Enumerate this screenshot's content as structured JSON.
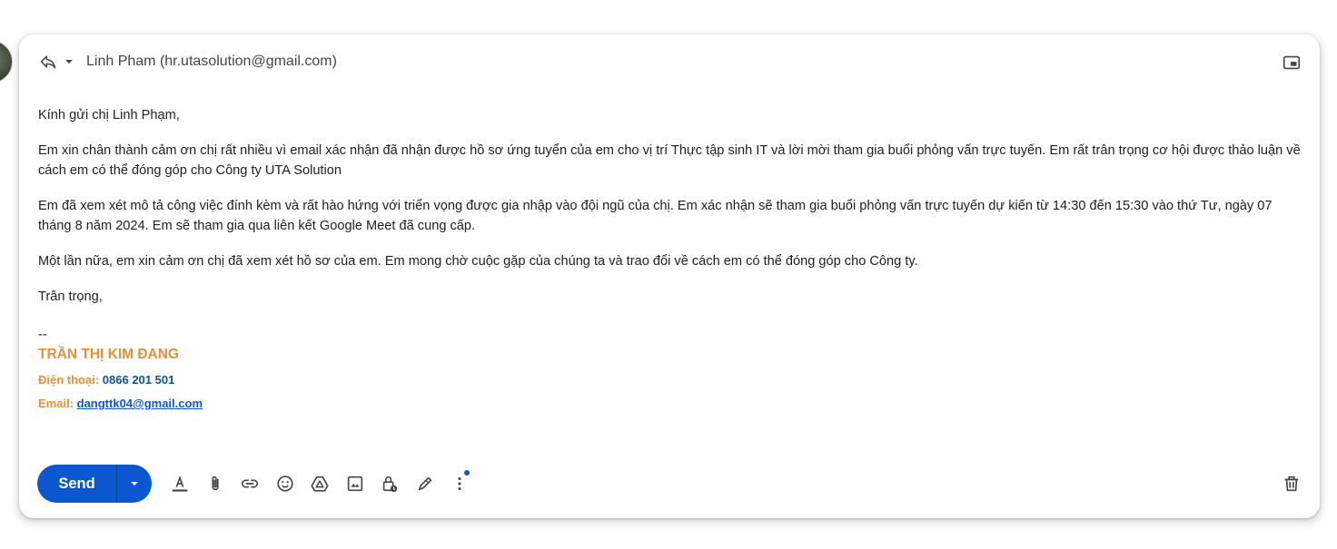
{
  "header": {
    "recipient": "Linh Pham (hr.utasolution@gmail.com)"
  },
  "body": {
    "greeting": "Kính gửi chị Linh Phạm,",
    "paragraphs": [
      "Em xin chân thành cảm ơn chị rất nhiều vì email xác nhận đã nhận được hồ sơ ứng tuyển của em cho vị trí Thực tập sinh IT và lời mời tham gia buổi phỏng vấn trực tuyến. Em rất trân trọng cơ hội được thảo luận về cách em có thể đóng góp cho Công ty UTA Solution",
      "Em đã xem xét mô tả công việc đính kèm và rất hào hứng với triển vọng được gia nhập vào đội ngũ của chị. Em xác nhận sẽ tham gia buổi phỏng vấn trực tuyến dự kiến từ 14:30 đến 15:30 vào thứ Tư, ngày 07 tháng 8 năm 2024. Em sẽ tham gia qua liên kết Google Meet đã cung cấp.",
      "Một lần nữa, em xin cảm ơn chị đã xem xét hồ sơ của em. Em mong chờ cuộc gặp của chúng ta và trao đổi về cách em có thể đóng góp cho Công ty."
    ],
    "closing": "Trân trọng,"
  },
  "signature": {
    "dash": "--",
    "name": "TRẦN THỊ KIM ĐANG",
    "phone_label": "Điện thoại: ",
    "phone": "0866 201 501",
    "email_label": "Email: ",
    "email": "dangttk04@gmail.com"
  },
  "toolbar": {
    "send_label": "Send",
    "icons": [
      "text-format-icon",
      "attach-icon",
      "link-icon",
      "emoji-icon",
      "drive-icon",
      "photo-icon",
      "confidential-lock-icon",
      "signature-pen-icon",
      "more-options-icon",
      "trash-icon"
    ]
  },
  "colors": {
    "send_blue": "#0b57d0",
    "signature_orange": "#e69138",
    "signature_phone": "#0b5394",
    "link_blue": "#1155cc"
  }
}
